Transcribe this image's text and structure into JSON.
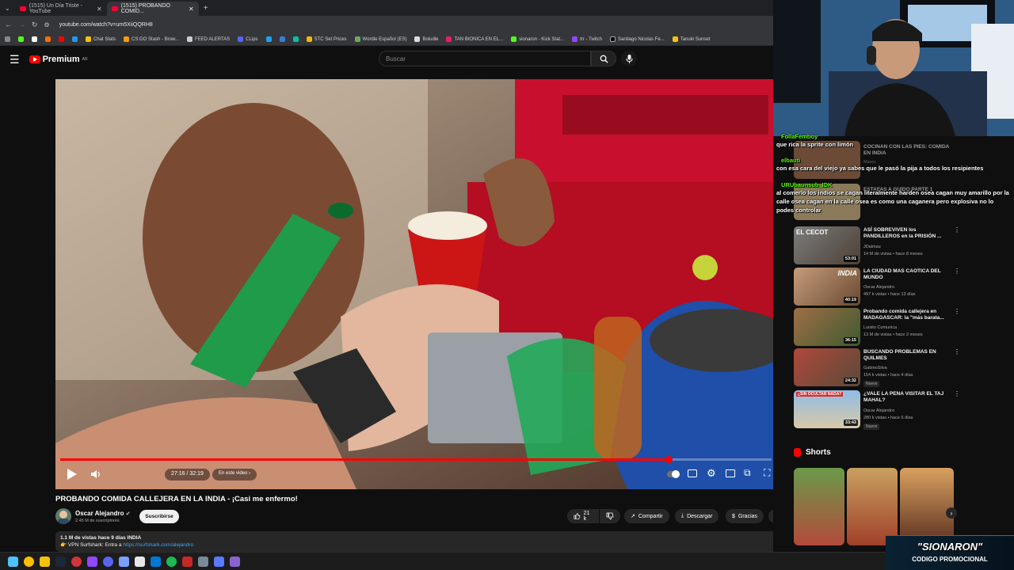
{
  "browser": {
    "tabs": [
      {
        "title": "(1515) Un Día Triste - YouTube"
      },
      {
        "title": "(1515) PROBANDO COMID..."
      }
    ],
    "url": "youtube.com/watch?v=um5XiiQQRH8",
    "bookmarks": [
      "Chat Stats",
      "CS:GO Stash - Brow...",
      "FEED ALERTAS",
      "CLips",
      "STC Set Prices",
      "Wordle Español (ES)",
      "Boludle",
      "TAN BIONICA EN EL...",
      "sionaron - Kick Stat...",
      "trr - Twitch",
      "Santiago Nicolas Fe...",
      "Tanuki Sunset"
    ]
  },
  "youtube": {
    "logo_text": "Premium",
    "logo_country": "AR",
    "search_placeholder": "Buscar"
  },
  "player": {
    "time": "27:16 / 32:19",
    "chapter": "En este video",
    "progress": 0.855
  },
  "video": {
    "title": "PROBANDO COMIDA CALLEJERA EN LA INDIA - ¡Casi me enfermo!",
    "channel": "Oscar Alejandro",
    "subscribers": "2.45 M de suscriptores",
    "subscribe_label": "Suscribirse",
    "likes": "21 k",
    "share_label": "Compartir",
    "download_label": "Descargar",
    "thanks_label": "Gracias",
    "description_line1": "1.1 M de vistas  hace 9 días  INDIA",
    "description_line2_prefix": "👉 VPN Surfshark: Entra a ",
    "description_link": "https://surfshark.com/alejandro"
  },
  "chat": [
    {
      "user": "FollaFemboy",
      "message": "que rica la sprite con limón"
    },
    {
      "user": "elbauti",
      "message": "con esa cara del viejo ya sabes que le pasó la pija a todos los resipientes"
    },
    {
      "user": "URUbaunsub_IDK",
      "message": "al comerlo los indios se cagan literalmente harden osea cagan muy amarillo por la calle osea cagan en la calle osea es como una caganera pero explosiva no lo podes controlar"
    }
  ],
  "recommendations": [
    {
      "title": "ASÍ SOBREVIVEN los PANDILLEROS en la PRISIÓN ...",
      "thumb_text": "EL CECOT",
      "channel": "JDaimau",
      "meta": "14 M de vistas • hace 8 meses",
      "duration": "53:01",
      "badge": ""
    },
    {
      "title": "LA CIUDAD MAS CAOTICA DEL MUNDO",
      "thumb_text": "INDIA",
      "channel": "Oscar Alejandro",
      "meta": "497 k vistas • hace 13 días",
      "duration": "40:19",
      "badge": ""
    },
    {
      "title": "Probando comida callejera en MADAGASCAR: la \"más barata...",
      "thumb_text": "",
      "channel": "Luisito Comunica",
      "meta": "13 M de vistas • hace 2 meses",
      "duration": "36:15",
      "badge": ""
    },
    {
      "title": "BUSCANDO PROBLEMAS EN QUILMES",
      "thumb_text": "",
      "channel": "GabinoSilva",
      "meta": "154 k vistas • hace 4 días",
      "duration": "24:32",
      "badge": "Nuevo"
    },
    {
      "title": "¿VALE LA PENA VISITAR EL TAJ MAHAL?",
      "thumb_text": "¿SIN OCULTAR NADA?",
      "channel": "Oscar Alejandro",
      "meta": "280 k vistas • hace 6 días",
      "duration": "33:43",
      "badge": "Nuevo"
    }
  ],
  "hidden_recs": [
    {
      "title": "COCINAN CON LAS PIES: COMIDA EN INDIA",
      "channel": "Marco"
    },
    {
      "title": "ESTAFAS A GUIDO PARTE 1"
    }
  ],
  "shorts_label": "Shorts",
  "promo": {
    "line1": "\"SIONARON\"",
    "line2": "CODIGO PROMOCIONAL"
  }
}
